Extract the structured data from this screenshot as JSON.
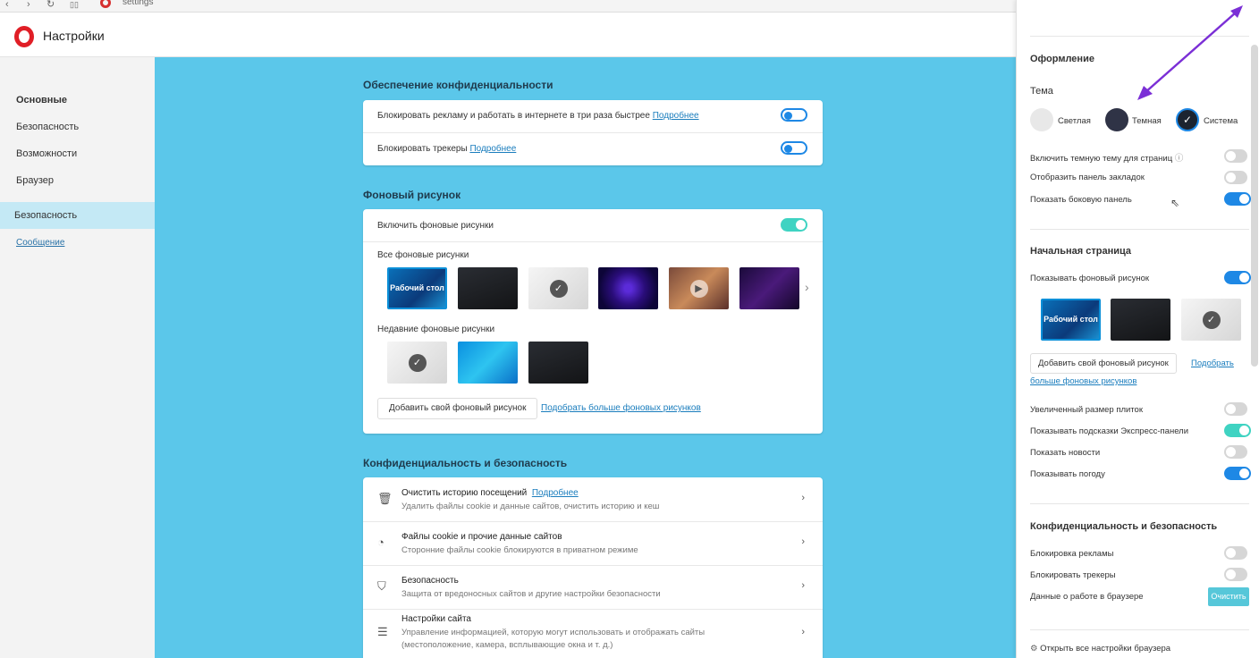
{
  "browser": {
    "url": "settings"
  },
  "header": {
    "title": "Настройки"
  },
  "sidebar": {
    "items": [
      {
        "label": "Основные"
      },
      {
        "label": "Безопасность"
      },
      {
        "label": "Возможности"
      },
      {
        "label": "Браузер"
      }
    ],
    "active": "Безопасность",
    "link": "Сообщение"
  },
  "privacy": {
    "title": "Обеспечение конфиденциальности",
    "rows": [
      {
        "label": "Блокировать рекламу и работать в интернете в три раза быстрее",
        "link": "Подробнее",
        "toggle": "on"
      },
      {
        "label": "Блокировать трекеры",
        "link": "Подробнее",
        "toggle": "on"
      }
    ]
  },
  "wallpaper": {
    "title": "Фоновый рисунок",
    "enable_label": "Включить фоновые рисунки",
    "all_label": "Все фоновые рисунки",
    "desktop_label": "Рабочий стол",
    "recent_label": "Недавние фоновые рисунки",
    "add_button": "Добавить свой фоновый рисунок",
    "more_link": "Подобрать больше фоновых рисунков"
  },
  "security": {
    "title": "Конфиденциальность и безопасность",
    "rows": [
      {
        "title": "Очистить историю посещений",
        "link": "Подробнее",
        "sub": "Удалить файлы cookie и данные сайтов, очистить историю и кеш",
        "icon": "trash-icon"
      },
      {
        "title": "Файлы cookie и прочие данные сайтов",
        "link": "",
        "sub": "Сторонние файлы cookie блокируются в приватном режиме",
        "icon": "cookie-icon"
      },
      {
        "title": "Безопасность",
        "link": "",
        "sub": "Защита от вредоносных сайтов и другие настройки безопасности",
        "icon": "shield-icon"
      },
      {
        "title": "Настройки сайта",
        "link": "",
        "sub": "Управление информацией, которую могут использовать и отображать сайты",
        "sub2": "(местоположение, камера, всплывающие окна и т. д.)",
        "icon": "sliders-icon"
      }
    ]
  },
  "panel": {
    "appearance_title": "Оформление",
    "theme_label": "Тема",
    "themes": [
      {
        "label": "Светлая",
        "color": "#e8e8e8"
      },
      {
        "label": "Темная",
        "color": "#2f3346"
      },
      {
        "label": "Система",
        "color": "#1c2430"
      }
    ],
    "dark_pages": "Включить темную тему для страниц",
    "bookmarks_bar": "Отобразить панель закладок",
    "sidebar_show": "Показать боковую панель",
    "start_title": "Начальная страница",
    "show_wallpaper": "Показывать фоновый рисунок",
    "desktop_label": "Рабочий стол",
    "add_wallpaper": "Добавить свой фоновый рисунок",
    "pick_link": "Подобрать",
    "more_link": "больше фоновых рисунков",
    "tile_size": "Увеличенный размер плиток",
    "speed_dial_hints": "Показывать подсказки Экспресс-панели",
    "show_news": "Показать новости",
    "show_weather": "Показывать погоду",
    "privacy_title": "Конфиденциальность и безопасность",
    "block_ads": "Блокировка рекламы",
    "block_trackers": "Блокировать трекеры",
    "browser_data": "Данные о работе в браузере",
    "clear_button": "Очистить",
    "open_all": "Открыть все настройки браузера"
  },
  "colors": {
    "accent": "#1e88e5",
    "teal": "#3fd3c2",
    "main_bg": "#5bc7ea",
    "annotation": "#7b2fd6"
  }
}
